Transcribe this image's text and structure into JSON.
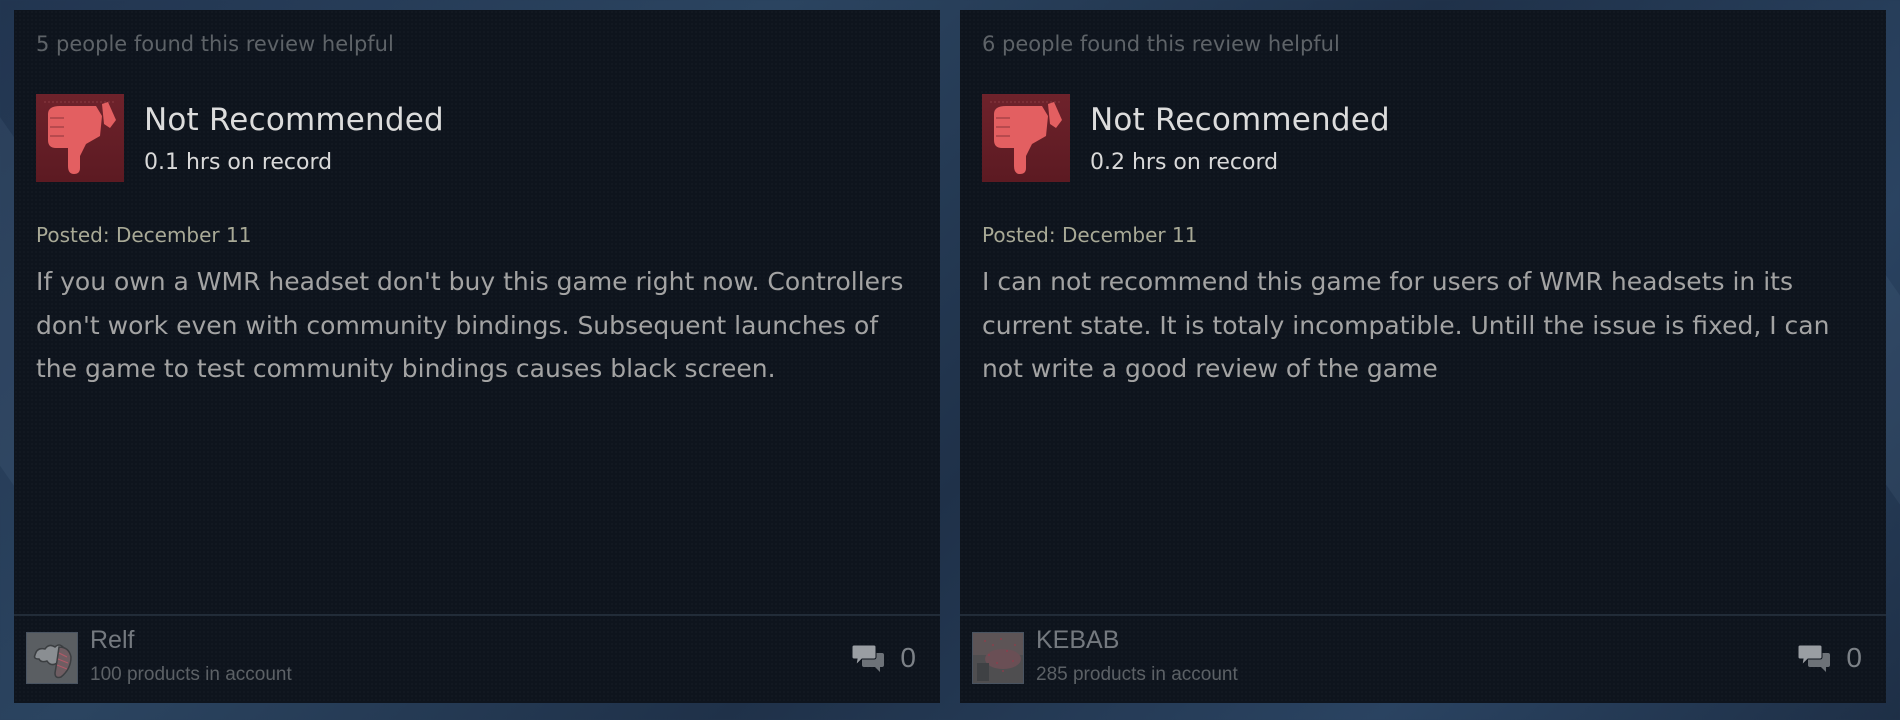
{
  "reviews": [
    {
      "helpful_text": "5 people found this review helpful",
      "recommendation": "Not Recommended",
      "recommendation_icon": "thumbs-down-icon",
      "hours": "0.1 hrs on record",
      "posted": "Posted: December 11",
      "body": "If you own a WMR headset don't buy this game right now. Controllers don't work even with community bindings. Subsequent launches of the game to test community bindings causes black screen.",
      "author": {
        "name": "Relf",
        "products": "100 products in account"
      },
      "comment_icon": "comment-icon",
      "comment_count": "0"
    },
    {
      "helpful_text": "6 people found this review helpful",
      "recommendation": "Not Recommended",
      "recommendation_icon": "thumbs-down-icon",
      "hours": "0.2 hrs on record",
      "posted": "Posted: December 11",
      "body": "I can not recommend this game for users of WMR headsets in its current state. It is totaly incompatible. Untill the issue is fixed, I can not write a good review of the game",
      "author": {
        "name": "KEBAB",
        "products": "285 products in account"
      },
      "comment_icon": "comment-icon",
      "comment_count": "0"
    }
  ],
  "colors": {
    "not_recommended_bg": "#6b1f28",
    "thumb": "#e35f61"
  }
}
